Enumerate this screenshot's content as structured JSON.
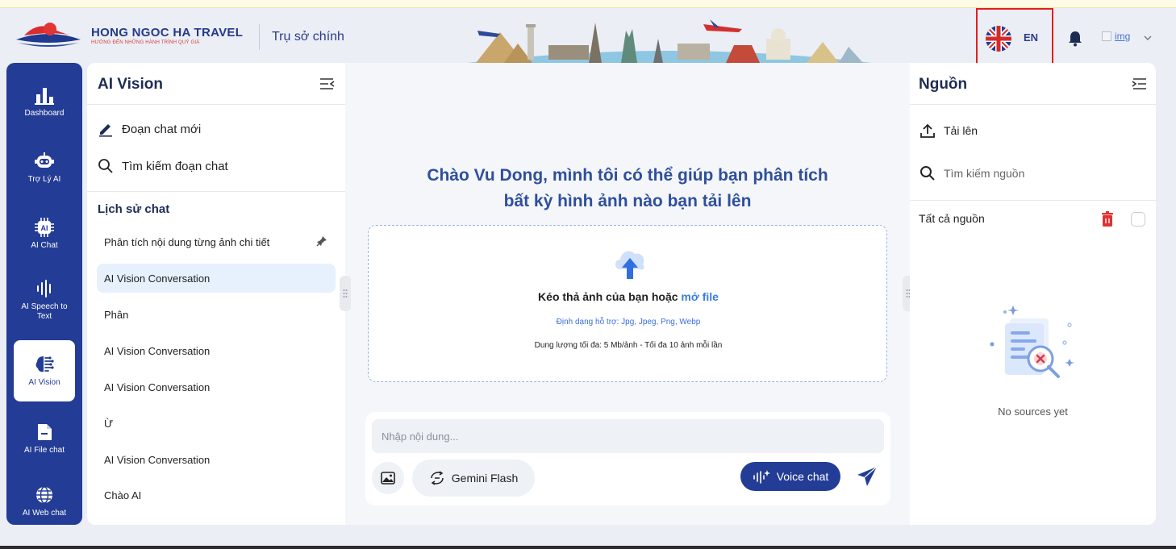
{
  "header": {
    "brand_name": "HONG NGOC HA TRAVEL",
    "brand_tagline": "HƯỚNG ĐẾN NHỮNG HÀNH TRÌNH QUÝ GIÁ",
    "branch": "Trụ sở chính",
    "language": "EN",
    "avatar_alt": "img"
  },
  "nav": [
    {
      "label": "Dashboard",
      "icon": "bar-chart-icon"
    },
    {
      "label": "Trợ Lý AI",
      "icon": "robot-icon"
    },
    {
      "label": "AI Chat",
      "icon": "ai-chip-icon"
    },
    {
      "label": "AI Speech to Text",
      "icon": "waveform-icon"
    },
    {
      "label": "AI Vision",
      "icon": "brain-icon",
      "active": true
    },
    {
      "label": "AI File chat",
      "icon": "file-chat-icon"
    },
    {
      "label": "AI Web chat",
      "icon": "globe-icon"
    }
  ],
  "conversations": {
    "title": "AI Vision",
    "new_chat": "Đoạn chat mới",
    "search": "Tìm kiếm đoạn chat",
    "history_title": "Lịch sử chat",
    "items": [
      "Phân tích nội dung từng ảnh chi tiết",
      "AI Vision Conversation",
      "Phân",
      "AI Vision Conversation",
      "AI Vision Conversation",
      "Ừ",
      "AI Vision Conversation",
      "Chào AI"
    ]
  },
  "main": {
    "welcome_line1": "Chào Vu Dong, mình tôi có thể giúp bạn phân tích",
    "welcome_line2": "bất kỳ hình ảnh nào bạn tải lên",
    "drop_text": "Kéo thả ảnh của bạn hoặc ",
    "drop_link": "mở file",
    "formats": "Định dạng hỗ trợ: Jpg, Jpeg, Png, Webp",
    "limits": "Dung lượng tối đa: 5 Mb/ảnh - Tối đa 10 ảnh mỗi lần",
    "input_placeholder": "Nhập nội dung...",
    "model": "Gemini Flash",
    "voice": "Voice chat"
  },
  "sources": {
    "title": "Nguồn",
    "upload": "Tải lên",
    "search": "Tìm kiếm nguồn",
    "all": "Tất cả nguồn",
    "empty": "No sources yet"
  },
  "colors": {
    "primary": "#233c95",
    "accent_blue": "#3a7de0",
    "highlight_red": "#e21f1f",
    "selected_bg": "#e7f0fd"
  }
}
